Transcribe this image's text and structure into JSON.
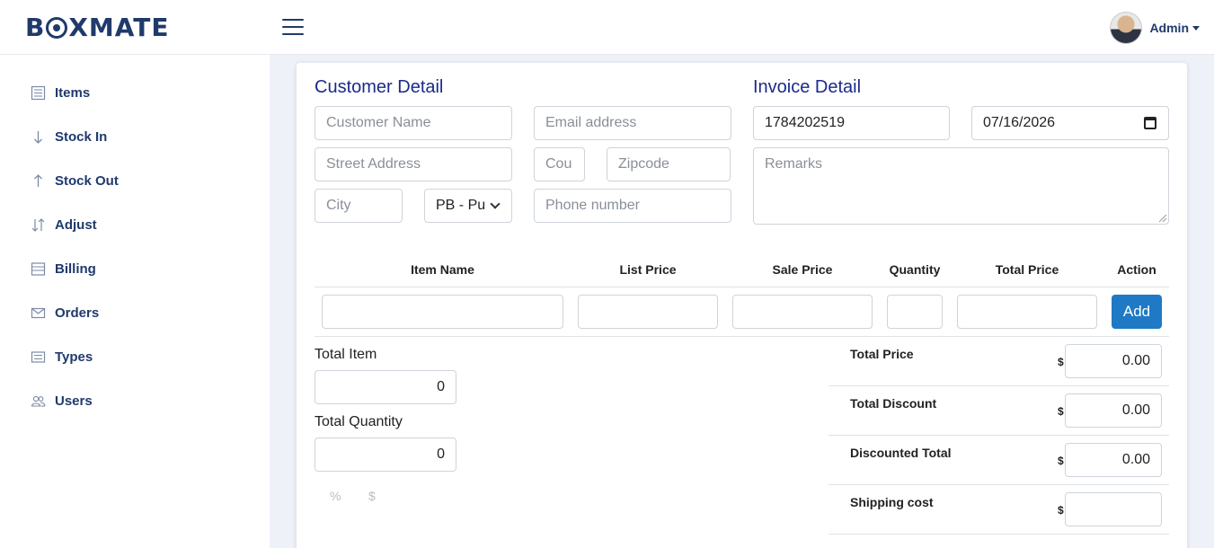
{
  "brand": {
    "logo_text_left": "B",
    "logo_text_right": "XMATE"
  },
  "header": {
    "user_name": "Admin"
  },
  "sidebar": {
    "items": [
      {
        "label": "Items",
        "icon": "list-icon"
      },
      {
        "label": "Stock In",
        "icon": "arrow-down-icon"
      },
      {
        "label": "Stock Out",
        "icon": "arrow-up-icon"
      },
      {
        "label": "Adjust",
        "icon": "arrows-updown-icon"
      },
      {
        "label": "Billing",
        "icon": "billing-icon"
      },
      {
        "label": "Orders",
        "icon": "envelope-icon"
      },
      {
        "label": "Types",
        "icon": "types-icon"
      },
      {
        "label": "Users",
        "icon": "users-icon"
      }
    ]
  },
  "customer": {
    "title": "Customer Detail",
    "name_placeholder": "Customer Name",
    "email_placeholder": "Email address",
    "street_placeholder": "Street Address",
    "country_placeholder": "Cou",
    "zip_placeholder": "Zipcode",
    "city_placeholder": "City",
    "state_value": "PB - Pu",
    "phone_placeholder": "Phone number"
  },
  "invoice": {
    "title": "Invoice Detail",
    "number": "1784202519",
    "date": "07/16/2026",
    "remarks_placeholder": "Remarks"
  },
  "table": {
    "headers": [
      "Item Name",
      "List Price",
      "Sale Price",
      "Quantity",
      "Total Price",
      "Action"
    ],
    "add_label": "Add"
  },
  "summary": {
    "total_item_label": "Total Item",
    "total_item_value": "0",
    "total_quantity_label": "Total Quantity",
    "total_quantity_value": "0",
    "percent_toggle": "%",
    "dollar_toggle": "$"
  },
  "totals": {
    "currency": "$",
    "rows": [
      {
        "label": "Total Price",
        "value": "0.00"
      },
      {
        "label": "Total Discount",
        "value": "0.00"
      },
      {
        "label": "Discounted Total",
        "value": "0.00"
      },
      {
        "label": "Shipping cost",
        "value": ""
      }
    ]
  },
  "colors": {
    "brand": "#1f3a6b",
    "title": "#1a2a8c",
    "primary_button": "#1f79c4"
  }
}
